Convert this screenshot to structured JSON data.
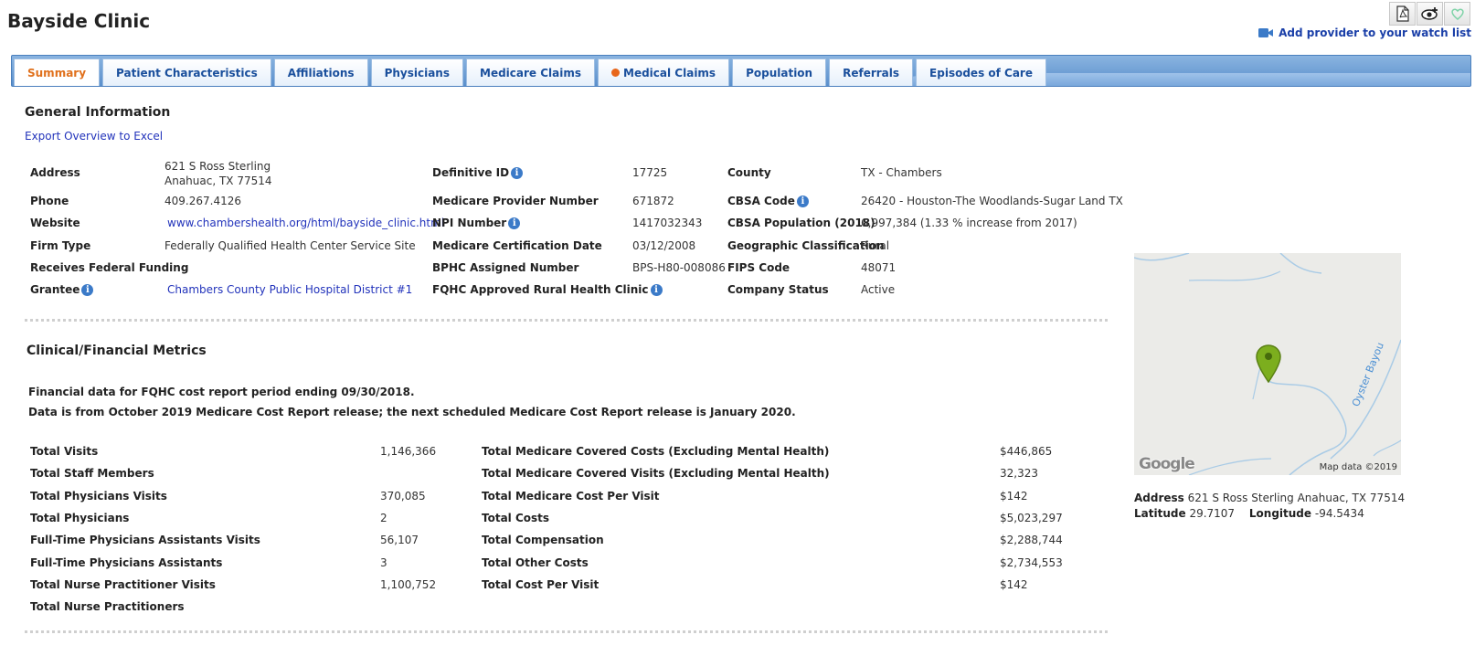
{
  "page": {
    "title": "Bayside Clinic"
  },
  "toolbar": {
    "watch_label": "Add provider to your watch list"
  },
  "tabs": [
    {
      "label": "Summary",
      "active": true
    },
    {
      "label": "Patient Characteristics"
    },
    {
      "label": "Affiliations"
    },
    {
      "label": "Physicians"
    },
    {
      "label": "Medicare Claims"
    },
    {
      "label": "Medical Claims",
      "indicator": "orange-dot"
    },
    {
      "label": "Population"
    },
    {
      "label": "Referrals"
    },
    {
      "label": "Episodes of Care"
    }
  ],
  "general": {
    "title": "General Information",
    "export_link": "Export Overview to Excel",
    "address_label": "Address",
    "address_line1": "621 S Ross Sterling",
    "address_line2": "Anahuac, TX 77514",
    "phone_label": "Phone",
    "phone": "409.267.4126",
    "website_label": "Website",
    "website": "www.chambershealth.org/html/bayside_clinic.html",
    "firm_type_label": "Firm Type",
    "firm_type": "Federally Qualified Health Center Service Site",
    "federal_funding_label": "Receives Federal Funding",
    "grantee_label": "Grantee",
    "grantee": "Chambers County Public Hospital District #1",
    "definitive_id_label": "Definitive ID",
    "definitive_id": "17725",
    "medicare_provider_label": "Medicare Provider Number",
    "medicare_provider": "671872",
    "npi_label": "NPI Number",
    "npi": "1417032343",
    "medicare_cert_label": "Medicare Certification Date",
    "medicare_cert": "03/12/2008",
    "bphc_label": "BPHC Assigned Number",
    "bphc": "BPS-H80-008086",
    "fqhc_label": "FQHC Approved Rural Health Clinic",
    "county_label": "County",
    "county": "TX - Chambers",
    "cbsa_code_label": "CBSA Code",
    "cbsa_code": "26420 - Houston-The Woodlands-Sugar Land TX",
    "cbsa_pop_label": "CBSA Population (2018)",
    "cbsa_pop": "6,997,384 (1.33 % increase from 2017)",
    "geo_label": "Geographic Classification",
    "geo": "Rural",
    "fips_label": "FIPS Code",
    "fips": "48071",
    "status_label": "Company Status",
    "status": "Active"
  },
  "clinical": {
    "title": "Clinical/Financial Metrics",
    "note1": "Financial data for FQHC cost report period ending 09/30/2018.",
    "note2": "Data is from October 2019 Medicare Cost Report release; the next scheduled Medicare Cost Report release is January 2020.",
    "left": [
      {
        "label": "Total Visits",
        "value": "1,146,366"
      },
      {
        "label": "Total Staff Members",
        "value": ""
      },
      {
        "label": "Total Physicians Visits",
        "value": "370,085"
      },
      {
        "label": "Total Physicians",
        "value": "2"
      },
      {
        "label": "Full-Time Physicians Assistants Visits",
        "value": "56,107"
      },
      {
        "label": "Full-Time Physicians Assistants",
        "value": "3"
      },
      {
        "label": "Total Nurse Practitioner Visits",
        "value": "1,100,752"
      },
      {
        "label": "Total Nurse Practitioners",
        "value": ""
      }
    ],
    "right": [
      {
        "label": "Total Medicare Covered Costs (Excluding Mental Health)",
        "value": "$446,865"
      },
      {
        "label": "Total Medicare Covered Visits (Excluding Mental Health)",
        "value": "32,323"
      },
      {
        "label": "Total Medicare Cost Per Visit",
        "value": "$142"
      },
      {
        "label": "Total Costs",
        "value": "$5,023,297"
      },
      {
        "label": "Total Compensation",
        "value": "$2,288,744"
      },
      {
        "label": "Total Other Costs",
        "value": "$2,734,553"
      },
      {
        "label": "Total Cost Per Visit",
        "value": "$142"
      }
    ]
  },
  "map": {
    "water_label": "Oyster Bayou",
    "logo": "Google",
    "attribution": "Map data ©2019",
    "address_label": "Address",
    "address": "621 S Ross Sterling Anahuac, TX 77514",
    "latitude_label": "Latitude",
    "latitude": "29.7107",
    "longitude_label": "Longitude",
    "longitude": "-94.5434"
  }
}
